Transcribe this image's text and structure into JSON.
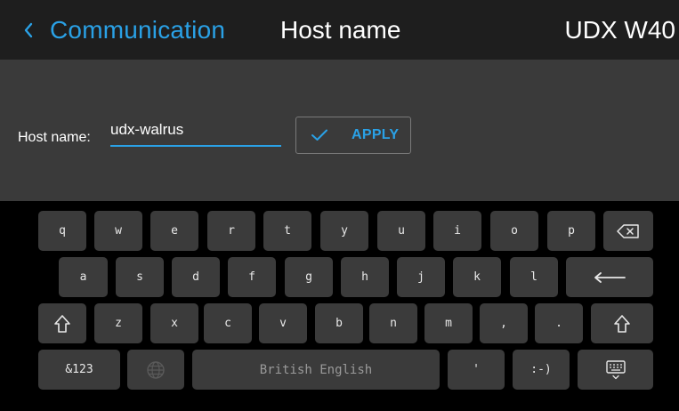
{
  "header": {
    "back_label": "Communication",
    "title": "Host name",
    "device": "UDX W40"
  },
  "form": {
    "host_label": "Host name:",
    "host_value": "udx-walrus",
    "apply_label": "APPLY"
  },
  "keyboard": {
    "row1": [
      "q",
      "w",
      "e",
      "r",
      "t",
      "y",
      "u",
      "i",
      "o",
      "p"
    ],
    "row2": [
      "a",
      "s",
      "d",
      "f",
      "g",
      "h",
      "j",
      "k",
      "l"
    ],
    "row3": [
      "z",
      "x",
      "c",
      "v",
      "b",
      "n",
      "m",
      ",",
      "."
    ],
    "symbols_label": "&123",
    "space_label": "British English",
    "apostrophe": "'",
    "emoticon": ":-)",
    "icons": {
      "backspace": "backspace-icon",
      "enter": "enter-icon",
      "shift": "shift-icon",
      "globe": "globe-icon",
      "hide_keyboard": "keyboard-hide-icon"
    }
  },
  "colors": {
    "accent": "#2aa1e6",
    "header_bg": "#1e1e1e",
    "panel_bg": "#3a3a3a",
    "key_bg": "#3b3b3b",
    "keyboard_bg": "#000000"
  }
}
